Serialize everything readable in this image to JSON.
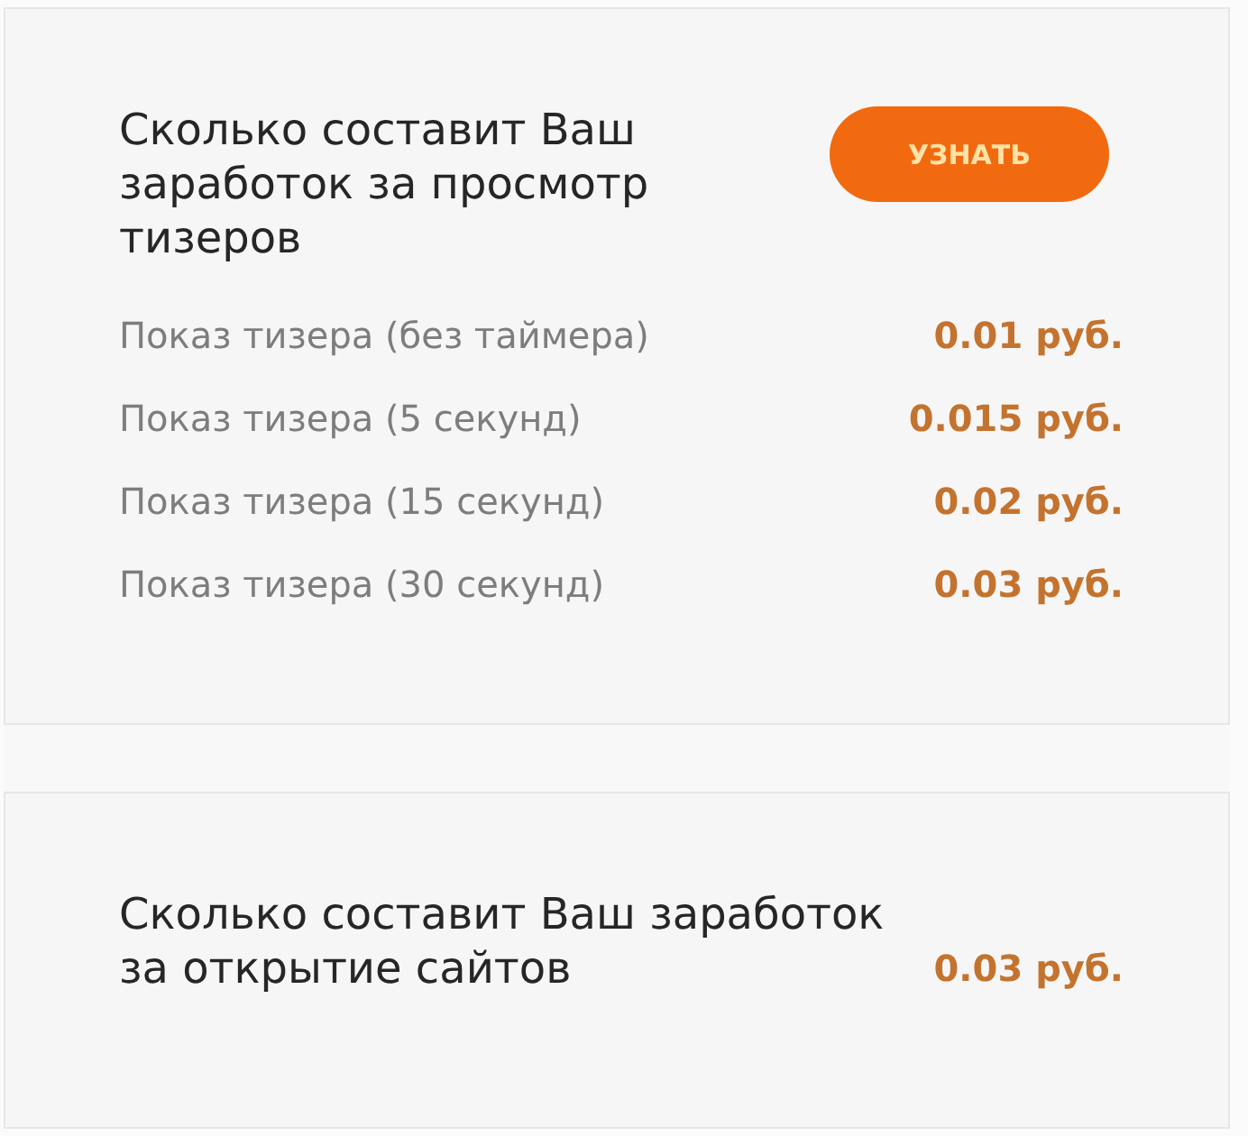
{
  "teaser_card": {
    "title": "Сколько составит Ваш заработок за просмотр тизеров",
    "button": "УЗНАТЬ",
    "rates": [
      {
        "label": "Показ тизера (без таймера)",
        "price": "0.01 руб."
      },
      {
        "label": "Показ тизера (5 секунд)",
        "price": "0.015 руб."
      },
      {
        "label": "Показ тизера (15 секунд)",
        "price": "0.02 руб."
      },
      {
        "label": "Показ тизера (30 секунд)",
        "price": "0.03 руб."
      }
    ]
  },
  "sites_card": {
    "title": "Сколько составит Ваш заработок за открытие сайтов",
    "price": "0.03 руб."
  }
}
